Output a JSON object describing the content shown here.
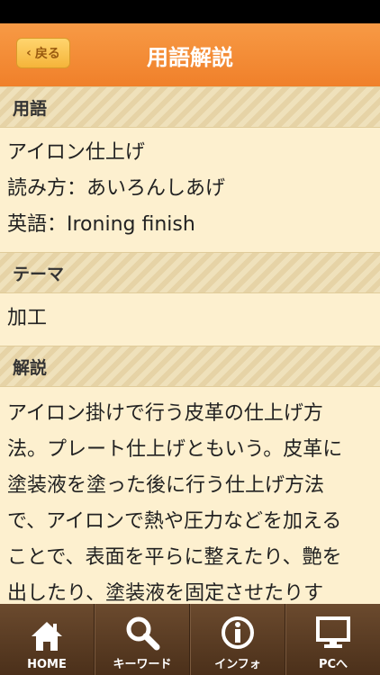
{
  "header": {
    "title": "用語解説",
    "back_label": "戻る"
  },
  "sections": [
    {
      "header": "用語",
      "lines": [
        "アイロン仕上げ",
        "読み方：あいろんしあげ",
        "英語：Ironing finish"
      ]
    },
    {
      "header": "テーマ",
      "lines": [
        "加工"
      ]
    },
    {
      "header": "解説",
      "lines": [
        "アイロン掛けで行う皮革の仕上げ方",
        "法。プレート仕上げともいう。皮革に",
        "塗装液を塗った後に行う仕上げ方法",
        "で、アイロンで熱や圧力などを加える",
        "ことで、表面を平らに整えたり、艶を",
        "出したり、塗装液を固定させたりす"
      ]
    }
  ],
  "tabs": [
    {
      "label": "HOME",
      "icon": "home-icon"
    },
    {
      "label": "キーワード",
      "icon": "search-icon"
    },
    {
      "label": "インフォ",
      "icon": "info-icon"
    },
    {
      "label": "PCへ",
      "icon": "monitor-icon"
    }
  ]
}
